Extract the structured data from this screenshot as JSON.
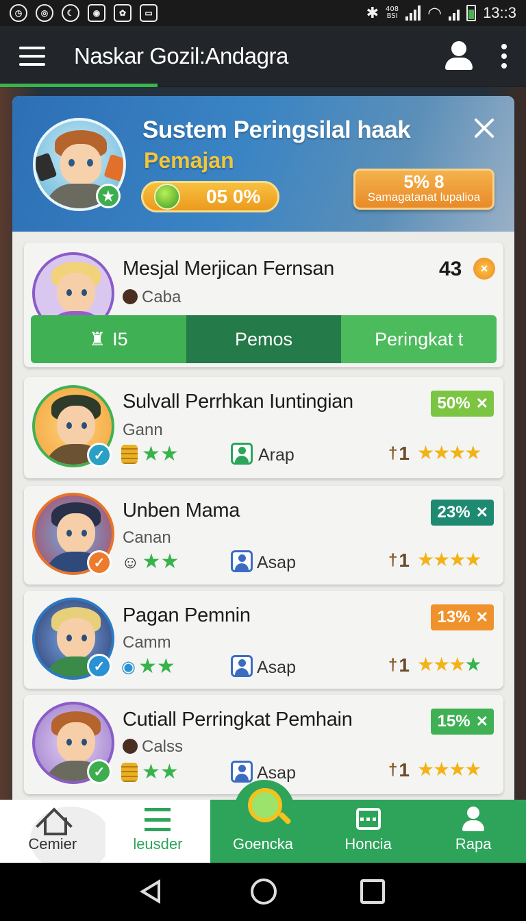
{
  "status_bar": {
    "time": "13::3",
    "network_top": "408",
    "network_bottom": "BSI"
  },
  "app_bar": {
    "title": "Naskar Gozil:Andagra"
  },
  "panel": {
    "title": "Sustem Peringsilal haak",
    "subtitle": "Pemajan",
    "progress_value": "05 0%",
    "stat_value": "5% 8",
    "stat_label": "Samagatanat lupalioa"
  },
  "first_card": {
    "name": "Mesjal Merjican Fernsan",
    "sub": "Caba",
    "score": "43",
    "tabs": [
      {
        "label": "I5"
      },
      {
        "label": "Pemos"
      },
      {
        "label": "Peringkat t"
      }
    ]
  },
  "players": [
    {
      "name": "Sulvall Perrhkan Iuntingian",
      "sub": "Gann",
      "tag": "50%",
      "tag_color": "#7cc542",
      "user_label": "Arap",
      "rank": "1"
    },
    {
      "name": "Unben Mama",
      "sub": "Canan",
      "tag": "23%",
      "tag_color": "#1f8a72",
      "user_label": "Asap",
      "rank": "1"
    },
    {
      "name": "Pagan Pemnin",
      "sub": "Camm",
      "tag": "13%",
      "tag_color": "#f0922c",
      "user_label": "Asap",
      "rank": "1"
    },
    {
      "name": "Cutiall Perringkat Pemhain",
      "sub": "Calss",
      "tag": "15%",
      "tag_color": "#3fb154",
      "user_label": "Asap",
      "rank": "1"
    }
  ],
  "bottom_nav": [
    {
      "label": "Cemier",
      "icon": "home-icon"
    },
    {
      "label": "leusder",
      "icon": "list-icon"
    },
    {
      "label": "Goencka",
      "icon": "search-icon"
    },
    {
      "label": "Honcia",
      "icon": "chat-icon"
    },
    {
      "label": "Rapa",
      "icon": "user-icon"
    }
  ]
}
